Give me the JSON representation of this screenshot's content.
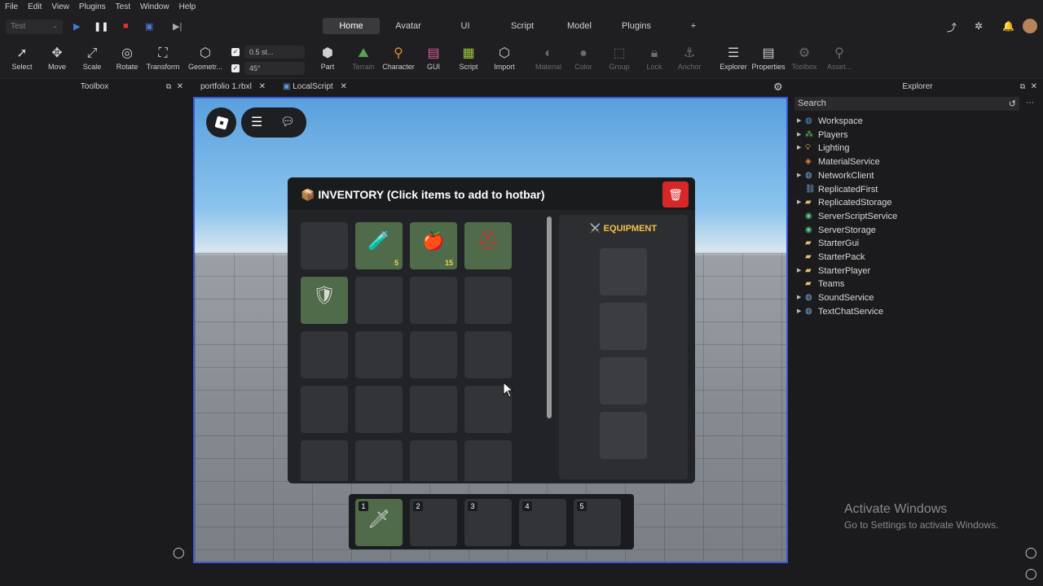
{
  "menu": [
    "File",
    "Edit",
    "View",
    "Plugins",
    "Test",
    "Window",
    "Help"
  ],
  "test_selector": "Test",
  "tabs": [
    "Home",
    "Avatar",
    "UI",
    "Script",
    "Model",
    "Plugins",
    "+"
  ],
  "ribbon": {
    "tools": [
      "Select",
      "Move",
      "Scale",
      "Rotate",
      "Transform",
      "Geometr..."
    ],
    "snap_move": "0.5 st...",
    "snap_rotate": "45°",
    "create": [
      "Part",
      "Terrain",
      "Character",
      "GUI",
      "Script",
      "Import"
    ],
    "modify": [
      "Material",
      "Color",
      "Group",
      "Lock",
      "Anchor"
    ],
    "panels": [
      "Explorer",
      "Properties",
      "Toolbox",
      "Asset..."
    ]
  },
  "toolbox": {
    "title": "Toolbox"
  },
  "doc_tabs": [
    "portfolio 1.rbxl",
    "LocalScript"
  ],
  "inventory": {
    "title": "📦 INVENTORY (Click items to add to hotbar)",
    "close_icon": "🗑",
    "items": [
      {
        "icon": "",
        "count": ""
      },
      {
        "icon": "🧪",
        "count": "5"
      },
      {
        "icon": "🍎",
        "count": "15"
      },
      {
        "icon": "⛑",
        "count": ""
      },
      {
        "icon": "🛡",
        "count": ""
      }
    ],
    "equipment_title": "⚔️ EQUIPMENT"
  },
  "hotbar": [
    {
      "n": "1",
      "icon": "🗡"
    },
    {
      "n": "2",
      "icon": ""
    },
    {
      "n": "3",
      "icon": ""
    },
    {
      "n": "4",
      "icon": ""
    },
    {
      "n": "5",
      "icon": ""
    }
  ],
  "explorer": {
    "title": "Explorer",
    "search_placeholder": "Search",
    "items": [
      "Workspace",
      "Players",
      "Lighting",
      "MaterialService",
      "NetworkClient",
      "ReplicatedFirst",
      "ReplicatedStorage",
      "ServerScriptService",
      "ServerStorage",
      "StarterGui",
      "StarterPack",
      "StarterPlayer",
      "Teams",
      "SoundService",
      "TextChatService"
    ]
  },
  "watermark": {
    "line1": "Activate Windows",
    "line2": "Go to Settings to activate Windows."
  }
}
